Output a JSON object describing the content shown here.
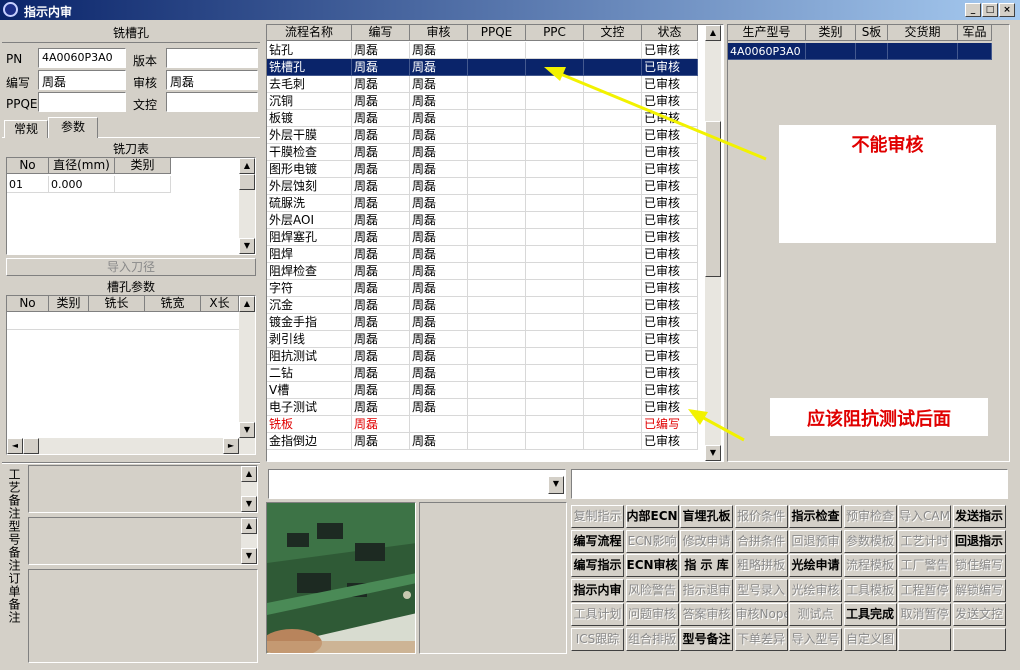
{
  "window": {
    "title": "指示内审",
    "min": "_",
    "max": "□",
    "close": "×"
  },
  "left": {
    "section_title": "铣槽孔",
    "form": {
      "pn_label": "PN",
      "pn_value": "4A0060P3A0",
      "version_label": "版本",
      "version_value": "",
      "writer_label": "编写",
      "writer_value": "周磊",
      "audit_label": "审核",
      "audit_value": "周磊",
      "ppqe_label": "PPQE",
      "ppqe_value": "",
      "control_label": "文控",
      "control_value": ""
    },
    "tabs": [
      "常规",
      "参数"
    ],
    "mill_table": {
      "title": "铣刀表",
      "headers": [
        "No",
        "直径(mm)",
        "类别"
      ],
      "rows": [
        [
          "01",
          "0.000",
          ""
        ]
      ]
    },
    "import_btn": "导入刀径",
    "slot_table": {
      "title": "槽孔参数",
      "headers": [
        "No",
        "类别",
        "铣长(mm)",
        "铣宽(mm)",
        "X长(mm"
      ]
    },
    "notes": [
      "工艺备注",
      "型号备注",
      "订单备注"
    ]
  },
  "flow": {
    "headers": [
      "流程名称",
      "编写",
      "审核",
      "PPQE",
      "PPC",
      "文控",
      "状态"
    ],
    "rows": [
      {
        "name": "钻孔",
        "writer": "周磊",
        "audit": "周磊",
        "status": "已审核"
      },
      {
        "name": "铣槽孔",
        "writer": "周磊",
        "audit": "周磊",
        "status": "已审核",
        "selected": true
      },
      {
        "name": "去毛刺",
        "writer": "周磊",
        "audit": "周磊",
        "status": "已审核"
      },
      {
        "name": "沉铜",
        "writer": "周磊",
        "audit": "周磊",
        "status": "已审核"
      },
      {
        "name": "板镀",
        "writer": "周磊",
        "audit": "周磊",
        "status": "已审核"
      },
      {
        "name": "外层干膜",
        "writer": "周磊",
        "audit": "周磊",
        "status": "已审核"
      },
      {
        "name": "干膜检查",
        "writer": "周磊",
        "audit": "周磊",
        "status": "已审核"
      },
      {
        "name": "图形电镀",
        "writer": "周磊",
        "audit": "周磊",
        "status": "已审核"
      },
      {
        "name": "外层蚀刻",
        "writer": "周磊",
        "audit": "周磊",
        "status": "已审核"
      },
      {
        "name": "硫脲洗",
        "writer": "周磊",
        "audit": "周磊",
        "status": "已审核"
      },
      {
        "name": "外层AOI",
        "writer": "周磊",
        "audit": "周磊",
        "status": "已审核"
      },
      {
        "name": "阻焊塞孔",
        "writer": "周磊",
        "audit": "周磊",
        "status": "已审核"
      },
      {
        "name": "阻焊",
        "writer": "周磊",
        "audit": "周磊",
        "status": "已审核"
      },
      {
        "name": "阻焊检查",
        "writer": "周磊",
        "audit": "周磊",
        "status": "已审核"
      },
      {
        "name": "字符",
        "writer": "周磊",
        "audit": "周磊",
        "status": "已审核"
      },
      {
        "name": "沉金",
        "writer": "周磊",
        "audit": "周磊",
        "status": "已审核"
      },
      {
        "name": "镀金手指",
        "writer": "周磊",
        "audit": "周磊",
        "status": "已审核"
      },
      {
        "name": "剥引线",
        "writer": "周磊",
        "audit": "周磊",
        "status": "已审核"
      },
      {
        "name": "阻抗测试",
        "writer": "周磊",
        "audit": "周磊",
        "status": "已审核"
      },
      {
        "name": "二钻",
        "writer": "周磊",
        "audit": "周磊",
        "status": "已审核"
      },
      {
        "name": "V槽",
        "writer": "周磊",
        "audit": "周磊",
        "status": "已审核"
      },
      {
        "name": "电子测试",
        "writer": "周磊",
        "audit": "周磊",
        "status": "已审核"
      },
      {
        "name": "铣板",
        "writer": "周磊",
        "audit": "",
        "status": "已编写",
        "red": true
      },
      {
        "name": "金指倒边",
        "writer": "周磊",
        "audit": "周磊",
        "status": "已审核"
      }
    ]
  },
  "right": {
    "headers": [
      "生产型号",
      "类别",
      "S板",
      "交货期",
      "军品"
    ],
    "rows": [
      [
        "4A0060P3A0",
        "",
        "",
        "",
        ""
      ]
    ]
  },
  "annotations": {
    "note1": "不能审核",
    "note2": "应该阻抗测试后面"
  },
  "buttons": [
    [
      "复制指示",
      "内部ECN",
      "盲埋孔板",
      "报价条件",
      "指示检查",
      "预审检查",
      "导入CAM",
      "发送指示"
    ],
    [
      "编写流程",
      "ECN影响",
      "修改申请",
      "合拼条件",
      "回退预审",
      "参数模板",
      "工艺计时",
      "回退指示"
    ],
    [
      "编写指示",
      "ECN审核",
      "指 示 库",
      "粗略拼板",
      "光绘申请",
      "流程模板",
      "工厂警告",
      "锁住编写"
    ],
    [
      "指示内审",
      "风险警告",
      "指示退审",
      "型号录入",
      "光绘审核",
      "工具模板",
      "工程暂停",
      "解锁编写"
    ],
    [
      "工具计划",
      "问题审核",
      "答案审核",
      "审核Nope",
      "测试点",
      "工具完成",
      "取消暂停",
      "发送文控"
    ],
    [
      "ICS跟踪",
      "组合排版",
      "型号备注",
      "下单差异",
      "导入型号",
      "自定义图",
      "",
      ""
    ]
  ],
  "button_state": [
    [
      1,
      2,
      2,
      1,
      2,
      1,
      1,
      2
    ],
    [
      2,
      1,
      1,
      1,
      1,
      1,
      1,
      2
    ],
    [
      2,
      2,
      2,
      1,
      2,
      1,
      1,
      1
    ],
    [
      2,
      1,
      1,
      1,
      1,
      1,
      1,
      1
    ],
    [
      1,
      1,
      1,
      1,
      1,
      2,
      1,
      1
    ],
    [
      1,
      1,
      2,
      1,
      1,
      1,
      0,
      0
    ]
  ],
  "colors": {
    "selection": "#0a246a",
    "red": "#e00000",
    "arrow": "#f2f200",
    "title": "#0a246a"
  },
  "icons": {
    "app": "app-icon",
    "up": "▲",
    "down": "▼",
    "left": "◄",
    "right": "►",
    "dropdown": "▼"
  }
}
